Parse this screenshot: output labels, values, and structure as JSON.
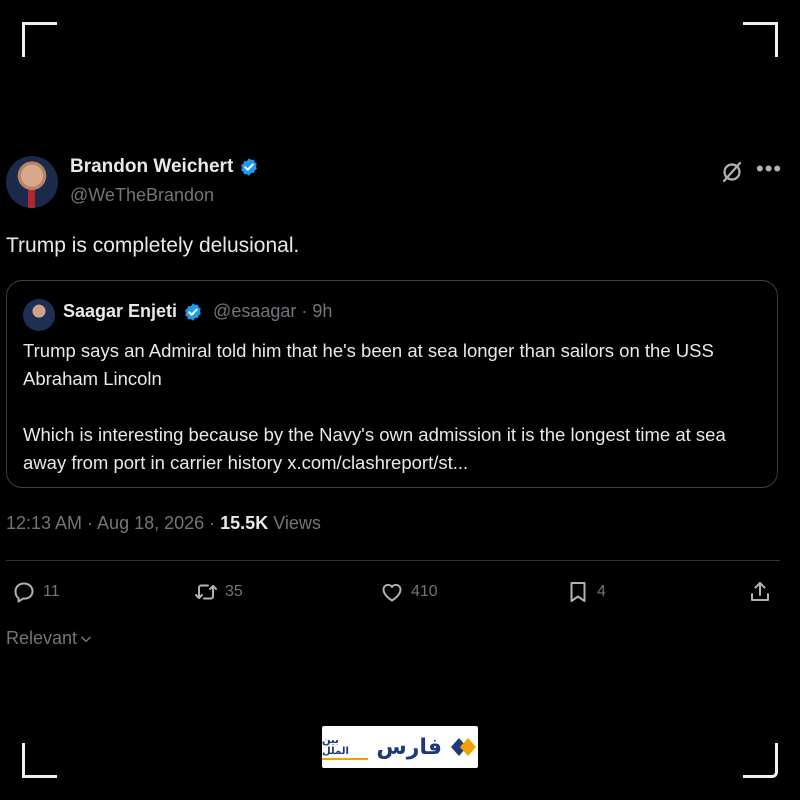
{
  "post": {
    "author_name": "Brandon Weichert",
    "author_handle": "@WeTheBrandon",
    "text": "Trump is completely delusional.",
    "timestamp": "12:13 AM · Aug 18, 2026 · ",
    "views_count": "15.5K",
    "views_label": " Views"
  },
  "quote": {
    "author_name": "Saagar Enjeti",
    "author_handle": "@esaagar · 9h",
    "paragraph1": "Trump says an Admiral told him that he's been at sea longer than sailors on the USS Abraham Lincoln",
    "paragraph2": "Which is interesting because by the Navy's own admission it is the longest time at sea away from port in carrier history x.com/clashreport/st..."
  },
  "actions": {
    "replies": "11",
    "reposts": "35",
    "likes": "410",
    "bookmarks": "4"
  },
  "sort": {
    "label": "Relevant"
  },
  "watermark": {
    "main": "فارس",
    "sub": "بین الملل"
  },
  "colors": {
    "background": "#000000",
    "verified": "#1d9bf0",
    "muted": "#71767b",
    "text": "#e7e9ea",
    "brand_blue": "#1b3a7a",
    "brand_orange": "#f2a100"
  },
  "icons": [
    "verified-badge-icon",
    "grok-icon",
    "more-icon",
    "reply-icon",
    "repost-icon",
    "like-icon",
    "bookmark-icon",
    "share-icon",
    "chevron-down-icon"
  ]
}
